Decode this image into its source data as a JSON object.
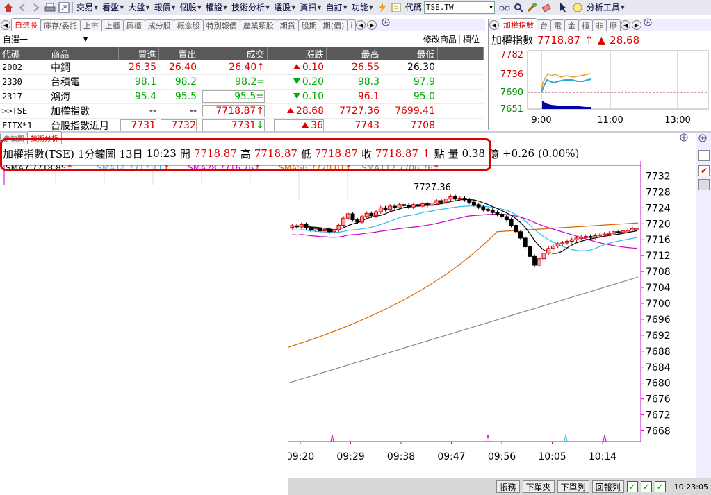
{
  "toolbar": {
    "menus": [
      "交易",
      "看盤",
      "大盤",
      "報價",
      "個股",
      "權證",
      "技術分析",
      "選股",
      "資訊",
      "自訂",
      "功能"
    ],
    "code_label": "代碼",
    "code_value": "TSE.TW",
    "tools_label": "分析工具"
  },
  "left_tabs": [
    "自選股",
    "庫存/委託",
    "上市",
    "上櫃",
    "興櫃",
    "成分股",
    "概念股",
    "特別報價",
    "產業類股",
    "期貨",
    "股期",
    "期(價)",
    "i"
  ],
  "list_selector": "自選一",
  "list_buttons": [
    "修改商品",
    "欄位"
  ],
  "quote_table": {
    "headers": [
      "代碼",
      "商品",
      "買進",
      "賣出",
      "成交",
      "漲跌",
      "最高",
      "最低"
    ],
    "rows": [
      {
        "code": "2002",
        "name": "中鋼",
        "bid": "26.35",
        "ask": "26.40",
        "last": "26.40",
        "last_mark": "↑",
        "chg": "0.10",
        "chg_dir": "up",
        "high": "26.55",
        "low": "26.30"
      },
      {
        "code": "2330",
        "name": "台積電",
        "bid": "98.1",
        "ask": "98.2",
        "last": "98.2",
        "last_mark": "=",
        "chg": "0.20",
        "chg_dir": "down",
        "high": "98.3",
        "low": "97.9"
      },
      {
        "code": "2317",
        "name": "鴻海",
        "bid": "95.4",
        "ask": "95.5",
        "last": "95.5",
        "last_mark": "=",
        "chg": "0.10",
        "chg_dir": "down",
        "high": "96.1",
        "low": "95.0"
      },
      {
        "code": ">>TSE",
        "name": "加權指數",
        "bid": "--",
        "ask": "--",
        "last": "7718.87",
        "last_mark": "↑",
        "chg": "28.68",
        "chg_dir": "up",
        "high": "7727.36",
        "low": "7699.41"
      },
      {
        "code": "FITX*1",
        "name": "台股指數近月",
        "bid": "7731",
        "ask": "7732",
        "last": "7731",
        "last_mark": "↓",
        "chg": "36",
        "chg_dir": "up",
        "high": "7743",
        "low": "7708"
      }
    ]
  },
  "right_tabs": [
    "加權指數",
    "台",
    "電",
    "金",
    "櫃",
    "非",
    "摩"
  ],
  "index_panel": {
    "name": "加權指數",
    "value": "7718.87",
    "change": "28.68",
    "y_ticks": [
      "7782",
      "7736",
      "7690",
      "7651"
    ],
    "x_ticks": [
      "9:00",
      "11:00",
      "13:00"
    ]
  },
  "lower_tabs": [
    "走勢圖",
    "技術分析"
  ],
  "infobar": {
    "name": "加權指數(TSE)",
    "interval": "1分鐘圖",
    "date": "13日",
    "time": "10:23",
    "open_label": "開",
    "open": "7718.87",
    "high_label": "高",
    "high": "7718.87",
    "low_label": "低",
    "low": "7718.87",
    "close_label": "收",
    "close": "7718.87",
    "unit": "點",
    "vol_label": "量",
    "vol": "0.38",
    "vol_unit": "億",
    "change": "+0.26",
    "change_pct": "(0.00%)"
  },
  "ma_legend": [
    {
      "label": "SMA7 7718.85",
      "color": "#000000"
    },
    {
      "label": "SMA14 7717.11",
      "color": "#33bbee"
    },
    {
      "label": "SMA28 7716.76",
      "color": "#cc00cc"
    },
    {
      "label": "SMA56 7720.01",
      "color": "#dd6600"
    },
    {
      "label": "SMA112 7706.76",
      "color": "#888888"
    }
  ],
  "chart_data": {
    "type": "candlestick",
    "title": "",
    "peak_label": "7727.36",
    "y_ticks": [
      "7732",
      "7728",
      "7724",
      "7720",
      "7716",
      "7712",
      "7708",
      "7704",
      "7700",
      "7696",
      "7692",
      "7688",
      "7684",
      "7680",
      "7676",
      "7672",
      "7668"
    ],
    "x_ticks": [
      "09:20",
      "09:29",
      "09:38",
      "09:47",
      "09:56",
      "10:05",
      "10:14"
    ],
    "ylim": [
      7666,
      7734
    ]
  },
  "statusbar": {
    "buttons": [
      "帳務",
      "下單夾",
      "下單列",
      "回報列"
    ],
    "clock": "10:23:05"
  },
  "colors": {
    "up": "#dd0000",
    "down": "#009900",
    "accent": "#dd0000"
  }
}
